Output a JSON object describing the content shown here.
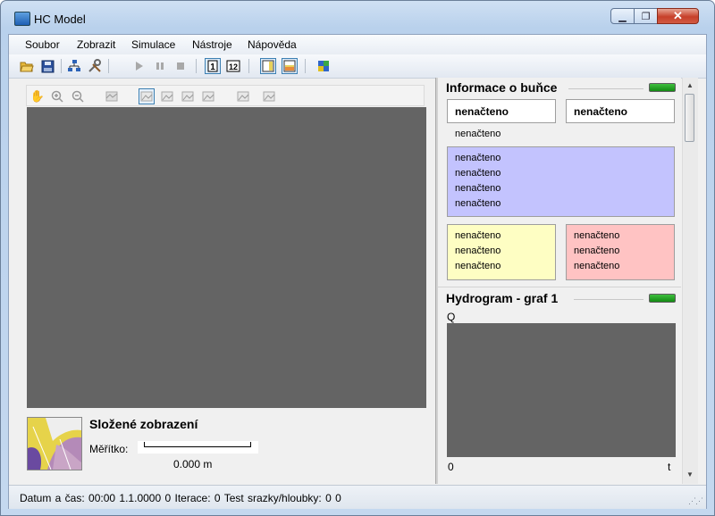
{
  "window": {
    "title": "HC Model"
  },
  "menu": [
    "Soubor",
    "Zobrazit",
    "Simulace",
    "Nástroje",
    "Nápověda"
  ],
  "map": {
    "view_title": "Složené zobrazení",
    "scale_label": "Měřítko:",
    "scale_value": "0.000 m"
  },
  "cell_info": {
    "title": "Informace o buňce",
    "box1": "nenačteno",
    "box2": "nenačteno",
    "line": "nenačteno",
    "blue_lines": [
      "nenačteno",
      "nenačteno",
      "nenačteno",
      "nenačteno"
    ],
    "yellow_lines": [
      "nenačteno",
      "nenačteno",
      "nenačteno"
    ],
    "red_lines": [
      "nenačteno",
      "nenačteno",
      "nenačteno"
    ],
    "colors": {
      "blue": "#c3c3fe",
      "yellow": "#fefec3",
      "red": "#ffc3c3"
    }
  },
  "hydrograph": {
    "title": "Hydrogram - graf 1",
    "y_label": "Q",
    "x_label": "t",
    "origin": "0"
  },
  "status": {
    "datetime_label": "Datum a čas:",
    "time": "00:00",
    "date": "1.1.0000",
    "value": "0",
    "iteration_label": "Iterace:",
    "iteration": "0",
    "test_label": "Test srazky/hloubky:",
    "test_a": "0",
    "test_b": "0"
  }
}
